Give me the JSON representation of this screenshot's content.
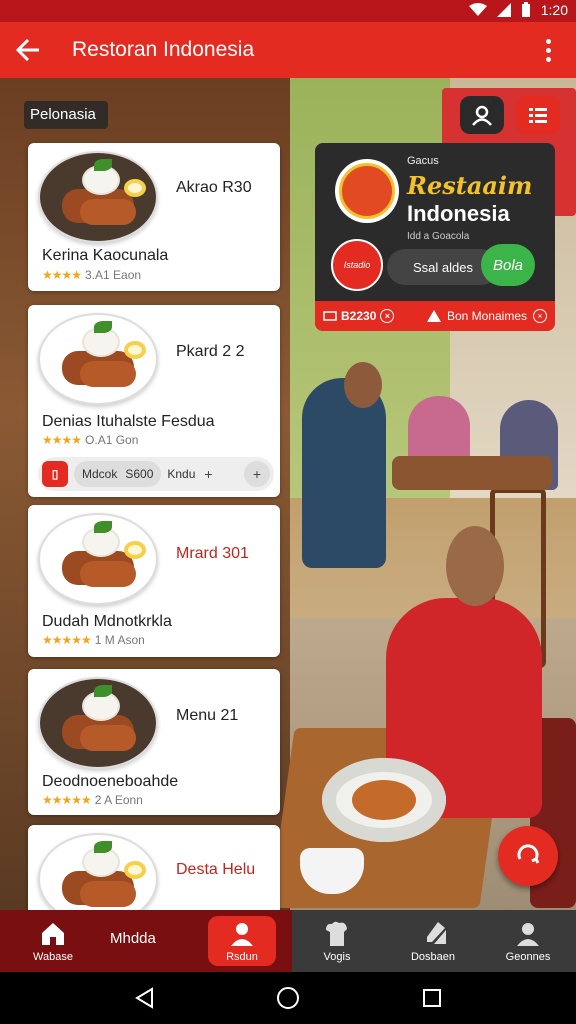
{
  "status_bar": {
    "time": "1:20"
  },
  "app_bar": {
    "title": "Restoran Indonesia"
  },
  "location_chip": "Pelonasia",
  "info_card": {
    "label_small": "Gacus",
    "name_line1": "Restaaim",
    "name_line2": "Indonesia",
    "subtitle": "Idd a Goacola",
    "badge_text": "Istadio",
    "pill_text": "Ssal aldes",
    "go_text": "Bola",
    "bottom_left": "B2230",
    "bottom_right": "Bon Monaimes"
  },
  "menu": {
    "items": [
      {
        "name": "Akrao R30",
        "desc": "Kerina Kaocunala",
        "rating": "3.A1 Eaon"
      },
      {
        "name": "Pkard 2 2",
        "desc": "Denias Ituhalste Fesdua",
        "rating": "O.A1 Gon"
      },
      {
        "name": "Mrard 301",
        "desc": "Dudah Mdnotkrkla",
        "rating": "1 M Ason"
      },
      {
        "name": "Menu 21",
        "desc": "Deodnoeneboahde",
        "rating": "2 A Eonn"
      },
      {
        "name": "Desta Helu",
        "desc": "",
        "rating": ""
      }
    ],
    "order_bar": {
      "label": "Mdcok",
      "price": "S600",
      "text": "Kndu"
    }
  },
  "bottom_nav": {
    "items": [
      {
        "label": "Wabase",
        "icon": "home-icon"
      },
      {
        "label": "Mhdda",
        "icon": ""
      },
      {
        "label": "Rsdun",
        "icon": "person-icon"
      },
      {
        "label": "Vogis",
        "icon": "chef-icon"
      },
      {
        "label": "Dosbaen",
        "icon": "note-icon"
      },
      {
        "label": "Geonnes",
        "icon": "person-icon"
      }
    ]
  },
  "colors": {
    "primary": "#e32b22",
    "dark_red": "#7a0f12",
    "nav_dark": "#3a3a3a",
    "star": "#f2a61c",
    "accent_green": "#3bb54a"
  }
}
